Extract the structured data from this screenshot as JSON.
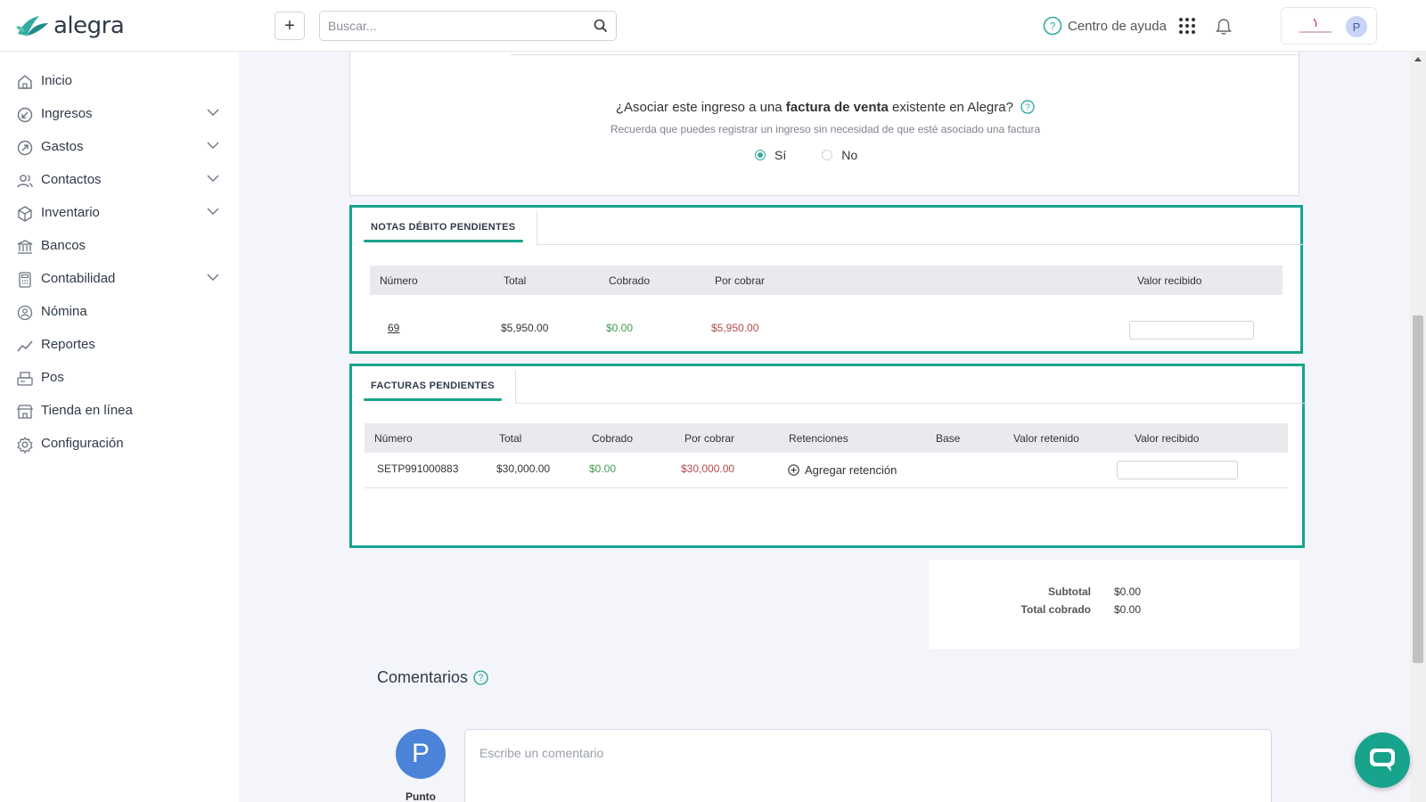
{
  "header": {
    "brand": "alegra",
    "search_placeholder": "Buscar...",
    "help_label": "Centro de ayuda",
    "avatar_initial": "P"
  },
  "sidebar": {
    "items": [
      {
        "label": "Inicio",
        "icon": "home-icon",
        "has_chevron": false
      },
      {
        "label": "Ingresos",
        "icon": "income-icon",
        "has_chevron": true
      },
      {
        "label": "Gastos",
        "icon": "expenses-icon",
        "has_chevron": true
      },
      {
        "label": "Contactos",
        "icon": "contacts-icon",
        "has_chevron": true
      },
      {
        "label": "Inventario",
        "icon": "inventory-icon",
        "has_chevron": true
      },
      {
        "label": "Bancos",
        "icon": "bank-icon",
        "has_chevron": false
      },
      {
        "label": "Contabilidad",
        "icon": "accounting-icon",
        "has_chevron": true
      },
      {
        "label": "Nómina",
        "icon": "payroll-icon",
        "has_chevron": false
      },
      {
        "label": "Reportes",
        "icon": "reports-icon",
        "has_chevron": false
      },
      {
        "label": "Pos",
        "icon": "pos-icon",
        "has_chevron": false
      },
      {
        "label": "Tienda en línea",
        "icon": "store-icon",
        "has_chevron": false
      },
      {
        "label": "Configuración",
        "icon": "settings-icon",
        "has_chevron": false
      }
    ]
  },
  "associate": {
    "question_pre": "¿Asociar este ingreso a una ",
    "question_bold": "factura de venta",
    "question_post": " existente en Alegra?",
    "hint": "Recuerda que puedes registrar un ingreso sin necesidad de que esté asociado una factura",
    "yes_label": "Sí",
    "no_label": "No",
    "selected": "yes"
  },
  "debit_notes": {
    "tab_label": "NOTAS DÉBITO PENDIENTES",
    "headers": {
      "numero": "Número",
      "total": "Total",
      "cobrado": "Cobrado",
      "por_cobrar": "Por cobrar",
      "valor_recibido": "Valor recibido"
    },
    "rows": [
      {
        "numero": "69",
        "total": "$5,950.00",
        "cobrado": "$0.00",
        "por_cobrar": "$5,950.00",
        "valor_recibido": ""
      }
    ]
  },
  "invoices": {
    "tab_label": "FACTURAS PENDIENTES",
    "headers": {
      "numero": "Número",
      "total": "Total",
      "cobrado": "Cobrado",
      "por_cobrar": "Por cobrar",
      "retenciones": "Retenciones",
      "base": "Base",
      "valor_retenido": "Valor retenido",
      "valor_recibido": "Valor recibido"
    },
    "rows": [
      {
        "numero": "SETP991000883",
        "total": "$30,000.00",
        "cobrado": "$0.00",
        "por_cobrar": "$30,000.00",
        "retenciones_action": "Agregar retención",
        "valor_recibido": ""
      }
    ]
  },
  "totals": {
    "subtotal_label": "Subtotal",
    "subtotal_value": "$0.00",
    "total_label": "Total cobrado",
    "total_value": "$0.00"
  },
  "comments": {
    "title": "Comentarios",
    "placeholder": "Escribe un comentario",
    "author_initial": "P",
    "author_name": "Punto"
  },
  "colors": {
    "accent": "#18a38c",
    "positive": "#3f9b52",
    "negative": "#b24a4a",
    "avatar": "#4a83d8"
  }
}
